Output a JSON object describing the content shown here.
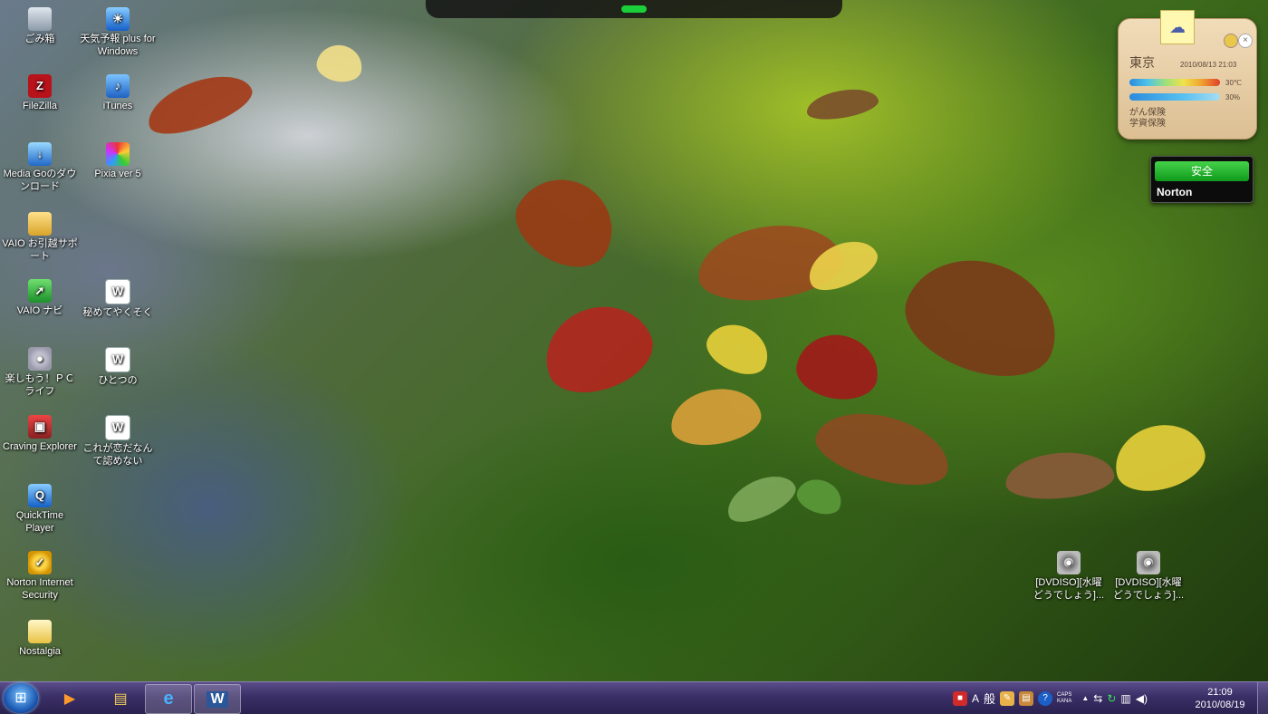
{
  "desktop": {
    "icons": [
      {
        "label": "ごみ箱",
        "icon": "recycle-bin-icon"
      },
      {
        "label": "天気予報 plus for Windows",
        "icon": "weather-app-icon"
      },
      {
        "label": "FileZilla",
        "icon": "filezilla-icon"
      },
      {
        "label": "iTunes",
        "icon": "itunes-icon"
      },
      {
        "label": "Media Goのダウンロード",
        "icon": "media-go-icon"
      },
      {
        "label": "Pixia ver 5",
        "icon": "pixia-icon"
      },
      {
        "label": "VAIO お引越サポート",
        "icon": "vaio-transfer-icon"
      },
      {
        "label": "VAIO ナビ",
        "icon": "vaio-navi-icon"
      },
      {
        "label": "秘めてやくそく",
        "icon": "word-document-icon"
      },
      {
        "label": "楽しもう！ＰＣライフ",
        "icon": "pc-life-icon"
      },
      {
        "label": "ひとつの",
        "icon": "word-document-icon"
      },
      {
        "label": "Craving Explorer",
        "icon": "craving-explorer-icon"
      },
      {
        "label": "これが恋だなんて認めない",
        "icon": "word-document-icon"
      },
      {
        "label": "QuickTime Player",
        "icon": "quicktime-icon"
      },
      {
        "label": "Norton Internet Security",
        "icon": "norton-icon"
      },
      {
        "label": "Nostalgia",
        "icon": "nostalgia-icon"
      },
      {
        "label": "[DVDISO][水曜どうでしょう]...",
        "icon": "disc-image-icon"
      },
      {
        "label": "[DVDISO][水曜どうでしょう]...",
        "icon": "disc-image-icon"
      }
    ]
  },
  "weather_gadget": {
    "city": "東京",
    "date": "2010/08/13 21:03",
    "temp_high": "30℃",
    "temp_low": "30%",
    "ad_line1": "がん保険",
    "ad_line2": "学資保険",
    "cloud_glyph": "☁"
  },
  "norton_gadget": {
    "status": "安全",
    "brand": "Norton",
    "status_color": "#1faa27"
  },
  "taskbar": {
    "start_glyph": "⊞",
    "apps": [
      {
        "name": "media-player",
        "glyph": "▶"
      },
      {
        "name": "file-explorer",
        "glyph": "▤"
      },
      {
        "name": "internet-explorer",
        "glyph": "e"
      },
      {
        "name": "word",
        "glyph": "W"
      }
    ],
    "tray": {
      "ime_mode": "A",
      "ime_label": "般",
      "caps_label": "CAPS",
      "kana_label": "KANA",
      "up_arrow": "▲"
    },
    "clock_time": "21:09",
    "clock_date": "2010/08/19"
  }
}
